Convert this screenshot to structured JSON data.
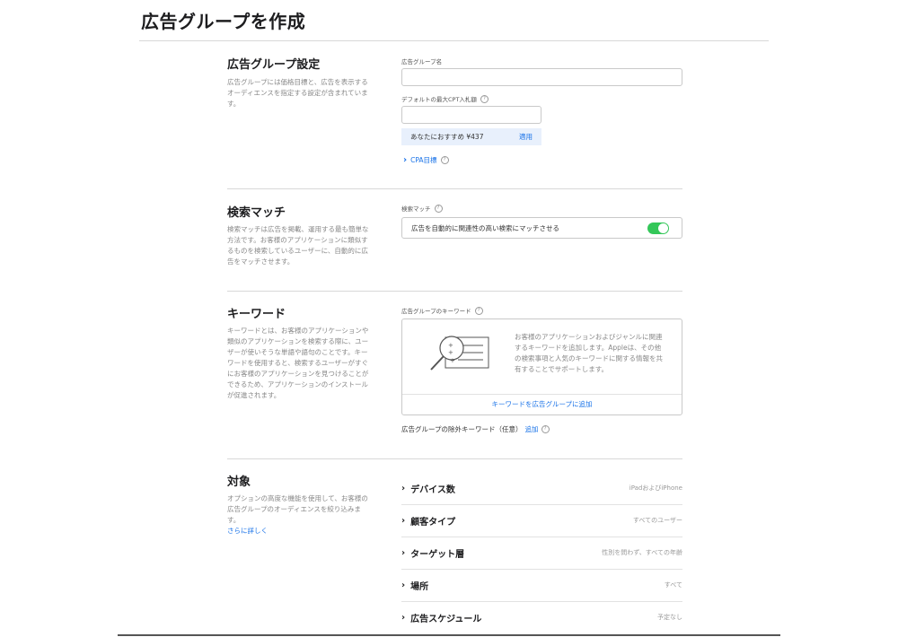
{
  "page": {
    "title": "広告グループを作成"
  },
  "settings": {
    "title": "広告グループ設定",
    "description": "広告グループには価格目標と、広告を表示するオーディエンスを指定する設定が含まれています。",
    "name_label": "広告グループ名",
    "name_value": "",
    "cpt_label": "デフォルトの最大CPT入札額",
    "cpt_value": "",
    "suggestion_text": "あなたにおすすめ ¥437",
    "apply_label": "適用",
    "cpa_label": "CPA目標"
  },
  "search_match": {
    "title": "検索マッチ",
    "description": "検索マッチは広告を掲載、運用する最も簡単な方法です。お客様のアプリケーションに類似するものを検索しているユーザーに、自動的に広告をマッチさせます。",
    "field_label": "検索マッチ",
    "toggle_text": "広告を自動的に関連性の高い検索にマッチさせる",
    "toggle_on": true
  },
  "keywords": {
    "title": "キーワード",
    "description": "キーワードとは、お客様のアプリケーションや類似のアプリケーションを検索する際に、ユーザーが使いそうな単語や語句のことです。キーワードを使用すると、検索するユーザーがすぐにお客様のアプリケーションを見つけることができるため、アプリケーションのインストールが促進されます。",
    "field_label": "広告グループのキーワード",
    "box_text": "お客様のアプリケーションおよびジャンルに関連するキーワードを追加します。Appleは、その他の検索事項と人気のキーワードに関する情報を共有することでサポートします。",
    "add_label": "キーワードを広告グループに追加",
    "negative_label": "広告グループの除外キーワード（任意）",
    "negative_add": "追加"
  },
  "audience": {
    "title": "対象",
    "description": "オプションの高度な機能を使用して、お客様の広告グループのオーディエンスを絞り込みます。",
    "learn_more": "さらに詳しく",
    "rows": [
      {
        "label": "デバイス数",
        "value": "iPadおよびiPhone"
      },
      {
        "label": "顧客タイプ",
        "value": "すべてのユーザー"
      },
      {
        "label": "ターゲット層",
        "value": "性別を問わず、すべての年齢"
      },
      {
        "label": "場所",
        "value": "すべて"
      },
      {
        "label": "広告スケジュール",
        "value": "予定なし"
      }
    ]
  },
  "colors": {
    "link": "#1a73e8",
    "toggle": "#34c759",
    "suggest_bg": "#e8f0fc"
  }
}
